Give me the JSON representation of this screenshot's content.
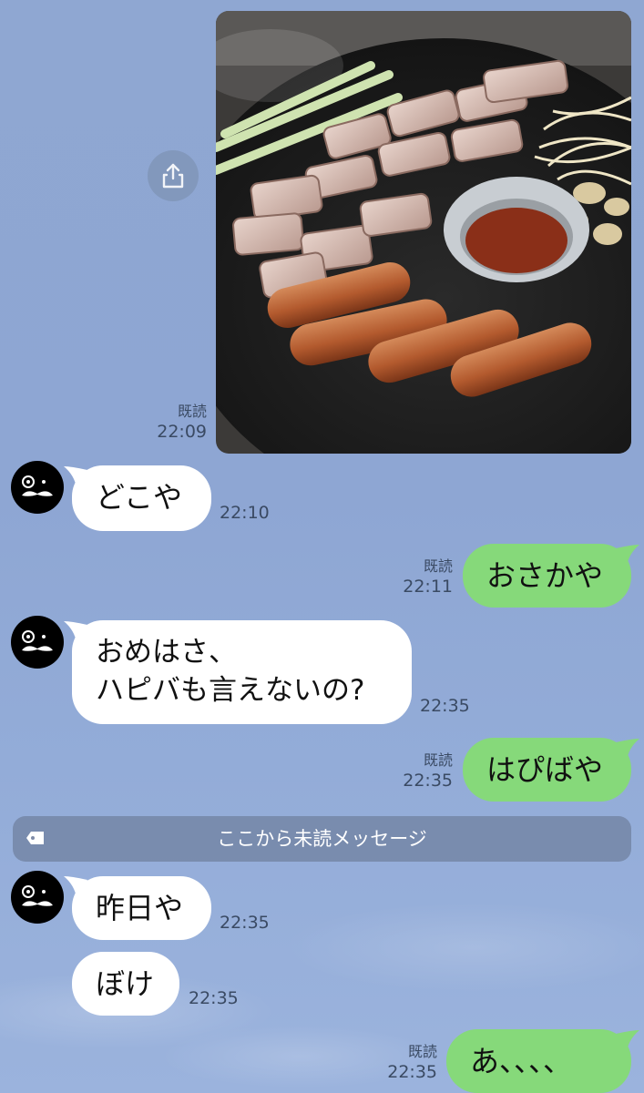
{
  "messages": [
    {
      "id": "m1",
      "side": "out",
      "type": "image",
      "read": "既読",
      "time": "22:09"
    },
    {
      "id": "m2",
      "side": "in",
      "text": "どこや",
      "time": "22:10"
    },
    {
      "id": "m3",
      "side": "out",
      "text": "おさかや",
      "read": "既読",
      "time": "22:11"
    },
    {
      "id": "m4",
      "side": "in",
      "line1": "おめはさ、",
      "line2": "ハピバも言えないの?",
      "time": "22:35"
    },
    {
      "id": "m5",
      "side": "out",
      "text": "はぴばや",
      "read": "既読",
      "time": "22:35"
    },
    {
      "id": "m6",
      "side": "in",
      "text": "昨日や",
      "time": "22:35"
    },
    {
      "id": "m7",
      "side": "in",
      "text": "ぼけ",
      "time": "22:35"
    },
    {
      "id": "m8",
      "side": "out",
      "text": "あ、、、、",
      "read": "既読",
      "time": "22:35"
    }
  ],
  "unread_divider": {
    "label": "ここから未読メッセージ"
  },
  "icons": {
    "share": "share-icon",
    "avatar": "mustache-avatar-icon",
    "tag": "tag-icon"
  },
  "colors": {
    "background": "#8fa7d2",
    "bubble_out": "#86d97a",
    "bubble_in": "#ffffff"
  }
}
